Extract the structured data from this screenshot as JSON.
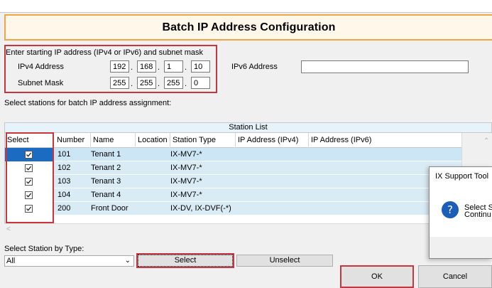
{
  "title": "Batch IP Address Configuration",
  "ip_section": {
    "instruction": "Enter starting IP address (IPv4 or IPv6) and subnet mask",
    "ipv4_label": "IPv4 Address",
    "ipv4": [
      "192",
      "168",
      "1",
      "10"
    ],
    "subnet_label": "Subnet Mask",
    "subnet": [
      "255",
      "255",
      "255",
      "0"
    ],
    "ipv6_label": "IPv6 Address",
    "ipv6_value": ""
  },
  "select_instruction": "Select stations for batch IP address assignment:",
  "station_list": {
    "title": "Station List",
    "columns": [
      "Select",
      "Number",
      "Name",
      "Location",
      "Station Type",
      "IP Address (IPv4)",
      "IP Address (IPv6)"
    ],
    "rows": [
      {
        "number": "101",
        "name": "Tenant 1",
        "location": "",
        "type": "IX-MV7-*",
        "ipv4": "",
        "ipv6": ""
      },
      {
        "number": "102",
        "name": "Tenant 2",
        "location": "",
        "type": "IX-MV7-*",
        "ipv4": "",
        "ipv6": ""
      },
      {
        "number": "103",
        "name": "Tenant 3",
        "location": "",
        "type": "IX-MV7-*",
        "ipv4": "",
        "ipv6": ""
      },
      {
        "number": "104",
        "name": "Tenant 4",
        "location": "",
        "type": "IX-MV7-*",
        "ipv4": "",
        "ipv6": ""
      },
      {
        "number": "200",
        "name": "Front Door",
        "location": "",
        "type": "IX-DV, IX-DVF(-*)",
        "ipv4": "",
        "ipv6": ""
      }
    ]
  },
  "by_type": {
    "label": "Select Station by Type:",
    "value": "All",
    "select_label": "Select",
    "unselect_label": "Unselect"
  },
  "ok_label": "OK",
  "cancel_label": "Cancel",
  "dialog": {
    "title": "IX Support Tool",
    "line1": "Select St",
    "line2": "Continu"
  },
  "colors": {
    "highlight_red": "#c8353e",
    "title_border": "#f0a646",
    "row_blue": "#d9ebf5",
    "selected_cell": "#1c6bc3"
  }
}
